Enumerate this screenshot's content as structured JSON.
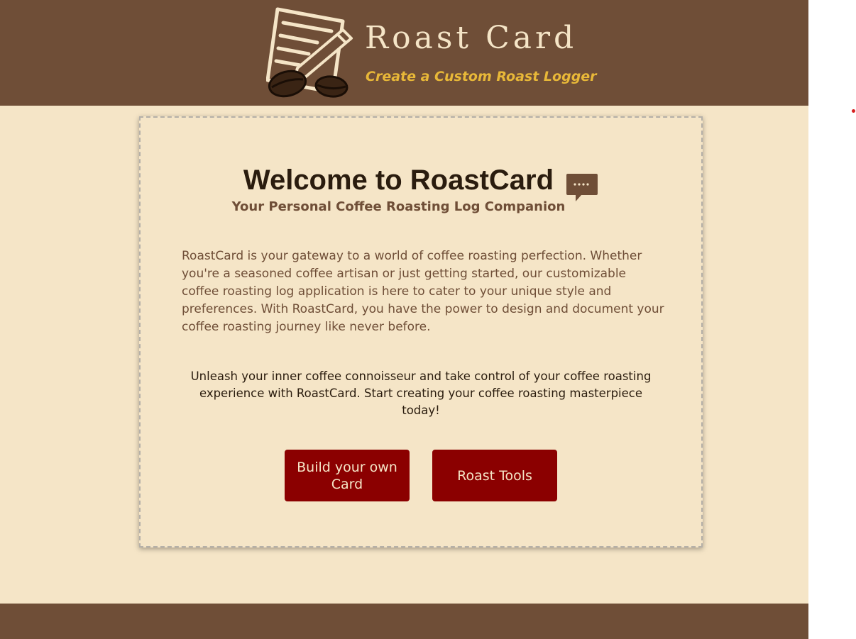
{
  "header": {
    "title": "Roast Card",
    "tagline": "Create a Custom Roast Logger",
    "logo_icon": "notepad-pencil-coffee-beans-icon"
  },
  "main": {
    "heading": "Welcome to RoastCard",
    "heading_icon": "chat-bubble-icon",
    "subheading": "Your Personal Coffee Roasting Log Companion",
    "intro": "RoastCard is your gateway to a world of coffee roasting perfection. Whether you're a seasoned coffee artisan or just getting started, our customizable coffee roasting log application is here to cater to your unique style and preferences. With RoastCard, you have the power to design and document your coffee roasting journey like never before.",
    "cta": "Unleash your inner coffee connoisseur and take control of your coffee roasting experience with RoastCard. Start creating your coffee roasting masterpiece today!",
    "buttons": {
      "build": "Build your own Card",
      "tools": "Roast Tools"
    }
  },
  "colors": {
    "brown": "#6f4e37",
    "cream": "#f5e5c7",
    "gold": "#e8b838",
    "button_red": "#8b0000"
  }
}
